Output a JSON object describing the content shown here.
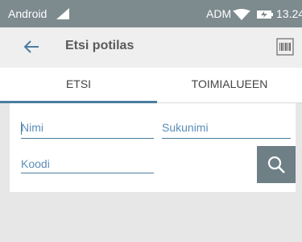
{
  "statusbar": {
    "carrier": "Android",
    "operator": "ADM",
    "time": "13.24",
    "signal_icon": "signal-icon",
    "wifi_icon": "wifi-icon",
    "battery_icon": "battery-charging-icon"
  },
  "appbar": {
    "title": "Etsi potilas",
    "back_icon": "back-arrow-icon",
    "barcode_icon": "barcode-scan-icon"
  },
  "tabs": [
    {
      "label": "ETSI",
      "active": true
    },
    {
      "label": "TOIMIALUEEN",
      "active": false
    }
  ],
  "form": {
    "first_name": {
      "placeholder": "Nimi",
      "value": ""
    },
    "last_name": {
      "placeholder": "Sukunimi",
      "value": ""
    },
    "code": {
      "placeholder": "Koodi",
      "value": ""
    },
    "search_icon": "search-icon"
  },
  "colors": {
    "statusbar": "#7d8a8e",
    "accent": "#4a7ea0",
    "field_text": "#5b8db8",
    "search_button": "#6e7f85",
    "background": "#e7e7e7"
  }
}
